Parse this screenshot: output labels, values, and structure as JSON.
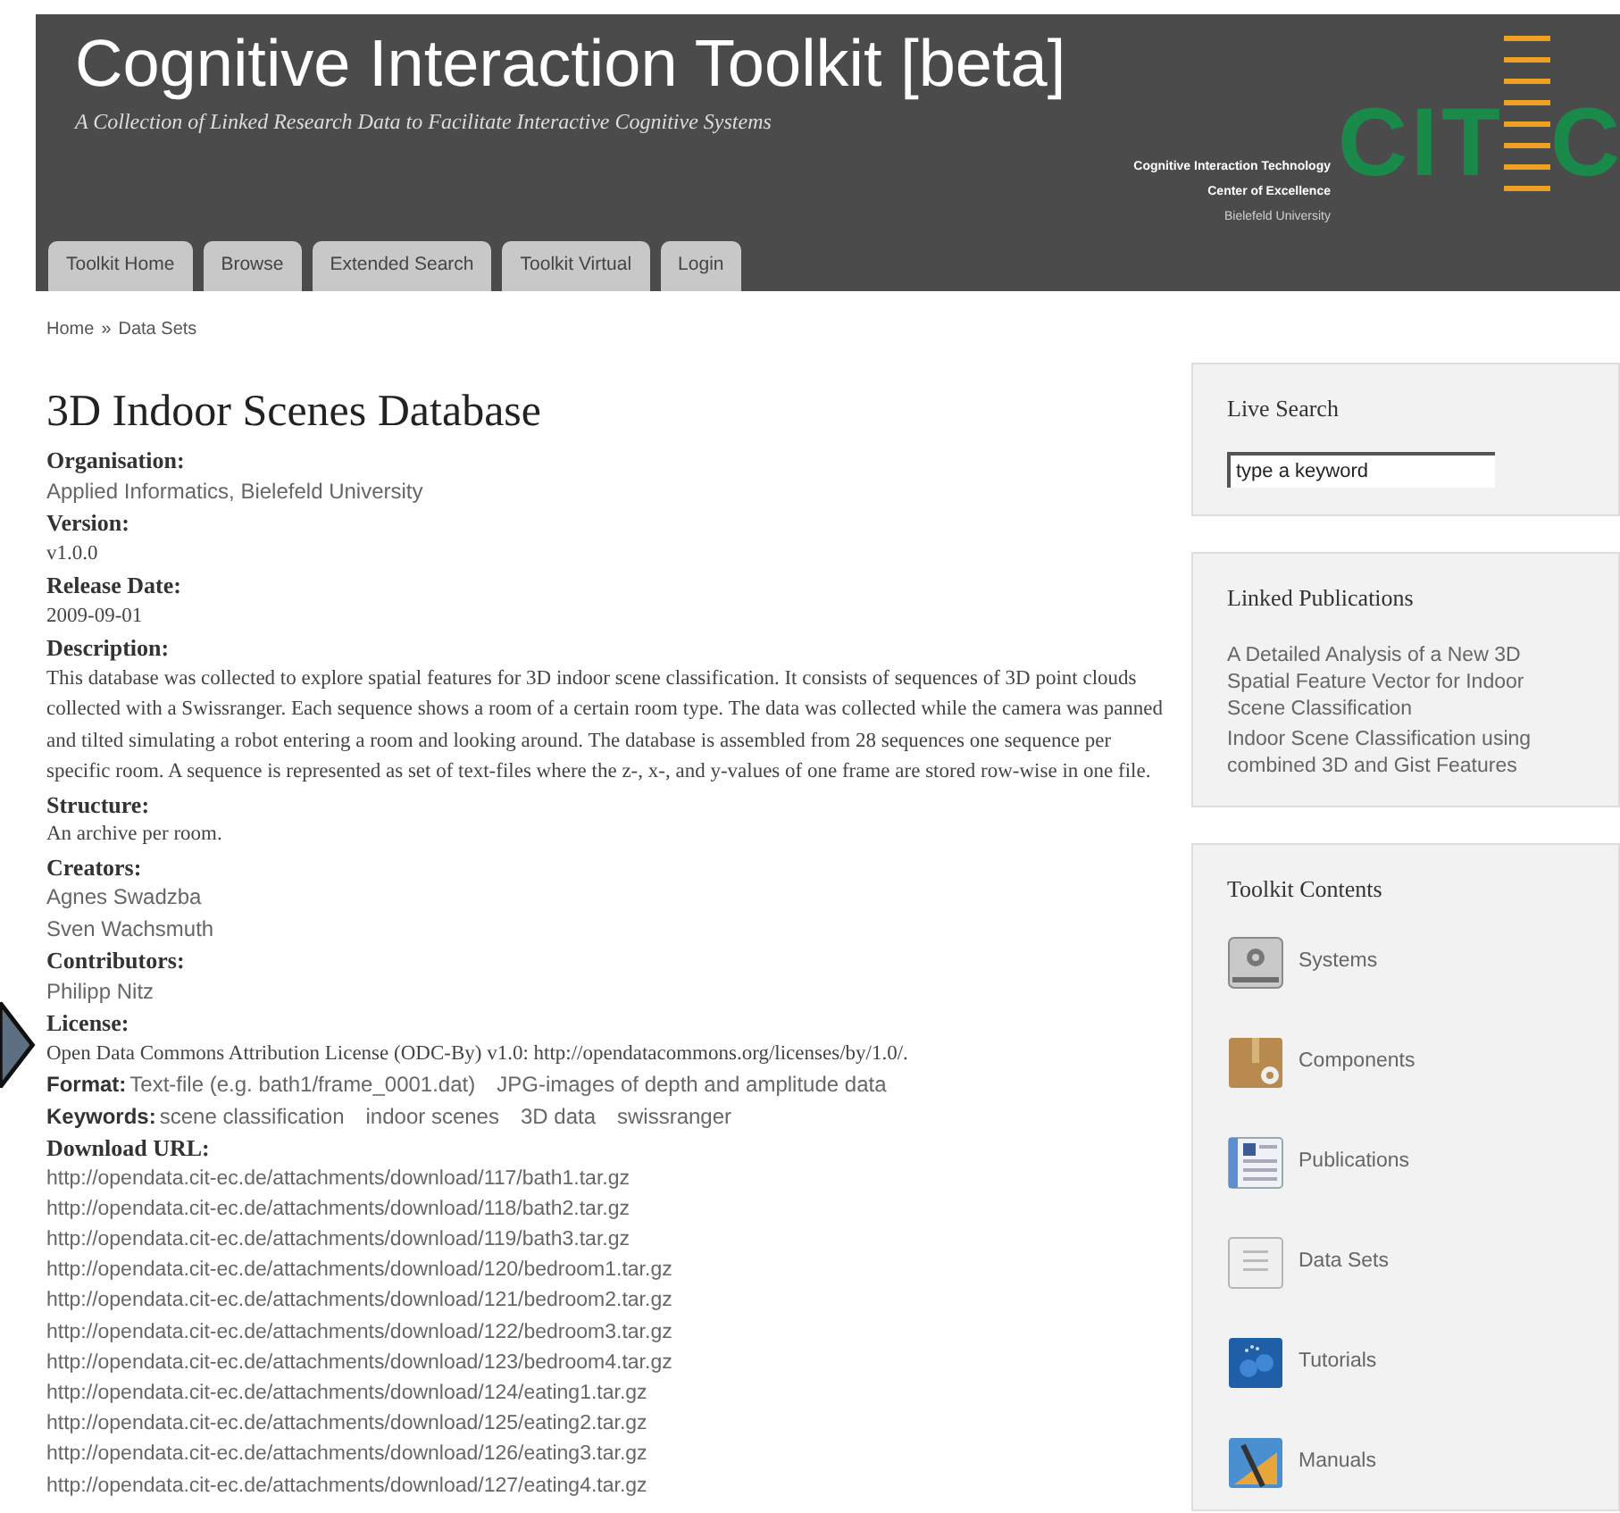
{
  "header": {
    "title": "Cognitive Interaction Toolkit [beta]",
    "subtitle": "A Collection of Linked Research Data to Facilitate Interactive Cognitive Systems",
    "logo": {
      "letters_left": "CIT",
      "letters_right": "C",
      "lines": [
        "Cognitive Interaction Technology",
        "Center of Excellence",
        "Bielefeld University"
      ]
    }
  },
  "tabs": [
    {
      "label": "Toolkit Home"
    },
    {
      "label": "Browse"
    },
    {
      "label": "Extended Search"
    },
    {
      "label": "Toolkit Virtual"
    },
    {
      "label": "Login"
    }
  ],
  "breadcrumb": [
    "Home",
    "»",
    "Data Sets"
  ],
  "page_title": "3D Indoor Scenes Database",
  "fields": [
    {
      "kind": "sans",
      "label": "Organisation:",
      "values": [
        "Applied Informatics, Bielefeld University"
      ]
    },
    {
      "kind": "serif",
      "label": "Version:",
      "values": [
        "v1.0.0"
      ]
    },
    {
      "kind": "serif",
      "label": "Release Date:",
      "values": [
        "2009-09-01"
      ]
    },
    {
      "kind": "serif",
      "label": "Description:",
      "values": [
        "This database was collected to explore spatial features for 3D indoor scene classification. It consists of sequences of 3D point clouds collected with a Swissranger. Each sequence shows a room of a certain room type. The data was collected while the camera was panned and tilted simulating a robot entering a room and looking around. The database is assembled from 28 sequences one sequence per specific room. A sequence is represented as set of text-files where the z-, x-, and y-values of one frame are stored row-wise in one file."
      ]
    },
    {
      "kind": "serif",
      "label": "Structure:",
      "values": [
        "An archive per room."
      ]
    },
    {
      "kind": "sans",
      "label": "Creators:",
      "values": [
        "Agnes Swadzba",
        "Sven Wachsmuth"
      ]
    },
    {
      "kind": "sans",
      "label": "Contributors:",
      "values": [
        "Philipp Nitz"
      ]
    },
    {
      "kind": "serif",
      "label": "License:",
      "values": [
        "Open Data Commons Attribution License (ODC-By) v1.0: http://opendatacommons.org/licenses/by/1.0/."
      ]
    }
  ],
  "format": {
    "label": "Format:",
    "items": [
      "Text-file (e.g. bath1/frame_0001.dat)",
      "JPG-images of depth and amplitude data"
    ]
  },
  "keywords": {
    "label": "Keywords:",
    "items": [
      "scene classification",
      "indoor scenes",
      "3D data",
      "swissranger"
    ]
  },
  "downloads": {
    "label": "Download URL:",
    "urls": [
      "http://opendata.cit-ec.de/attachments/download/117/bath1.tar.gz",
      "http://opendata.cit-ec.de/attachments/download/118/bath2.tar.gz",
      "http://opendata.cit-ec.de/attachments/download/119/bath3.tar.gz",
      "http://opendata.cit-ec.de/attachments/download/120/bedroom1.tar.gz",
      "http://opendata.cit-ec.de/attachments/download/121/bedroom2.tar.gz",
      "http://opendata.cit-ec.de/attachments/download/122/bedroom3.tar.gz",
      "http://opendata.cit-ec.de/attachments/download/123/bedroom4.tar.gz",
      "http://opendata.cit-ec.de/attachments/download/124/eating1.tar.gz",
      "http://opendata.cit-ec.de/attachments/download/125/eating2.tar.gz",
      "http://opendata.cit-ec.de/attachments/download/126/eating3.tar.gz",
      "http://opendata.cit-ec.de/attachments/download/127/eating4.tar.gz"
    ]
  },
  "sidebar": {
    "live_search": {
      "title": "Live Search",
      "placeholder": "type a keyword"
    },
    "linked_publications": {
      "title": "Linked Publications",
      "items": [
        "A Detailed Analysis of a New 3D Spatial Feature Vector for Indoor Scene Classification",
        "Indoor Scene Classification using combined 3D and Gist Features"
      ]
    },
    "toolkit_contents": {
      "title": "Toolkit Contents",
      "items": [
        {
          "kind": "systems",
          "label": "Systems"
        },
        {
          "kind": "components",
          "label": "Components"
        },
        {
          "kind": "publications",
          "label": "Publications"
        },
        {
          "kind": "datasets",
          "label": "Data Sets"
        },
        {
          "kind": "tutorials",
          "label": "Tutorials"
        },
        {
          "kind": "manuals",
          "label": "Manuals"
        }
      ]
    }
  }
}
